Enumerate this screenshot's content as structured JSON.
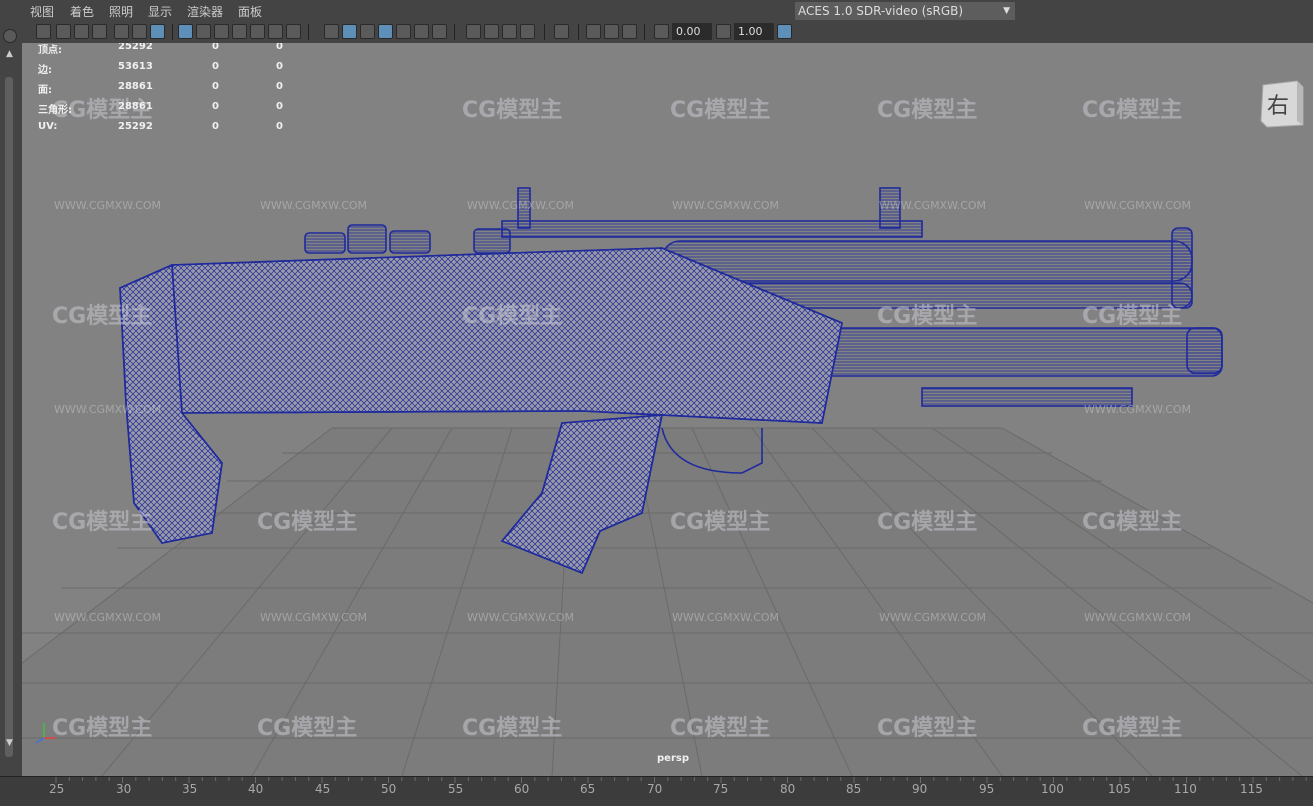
{
  "menu": [
    "视图",
    "着色",
    "照明",
    "显示",
    "渲染器",
    "面板"
  ],
  "toolbar": {
    "exposure": "0.00",
    "gamma": "1.00",
    "colorspace": "ACES 1.0 SDR-video (sRGB)"
  },
  "hud": {
    "rows": [
      {
        "label": "顶点:",
        "v1": "25292",
        "v2": "0",
        "v3": "0"
      },
      {
        "label": "边:",
        "v1": "53613",
        "v2": "0",
        "v3": "0"
      },
      {
        "label": "面:",
        "v1": "28861",
        "v2": "0",
        "v3": "0"
      },
      {
        "label": "三角形:",
        "v1": "28861",
        "v2": "0",
        "v3": "0"
      },
      {
        "label": "UV:",
        "v1": "25292",
        "v2": "0",
        "v3": "0"
      }
    ]
  },
  "viewcube_label": "右",
  "camera_name": "persp",
  "watermark": {
    "logo": "CG模型主",
    "url": "WWW.CGMXW.COM"
  },
  "timeline": [
    "25",
    "30",
    "35",
    "40",
    "45",
    "50",
    "55",
    "60",
    "65",
    "70",
    "75",
    "80",
    "85",
    "90",
    "95",
    "100",
    "105",
    "110",
    "115"
  ],
  "colors": {
    "wire": "#1f2a9c",
    "mesh": "#9a9aa6",
    "bg": "#828282",
    "grid": "#6e6e6e"
  }
}
